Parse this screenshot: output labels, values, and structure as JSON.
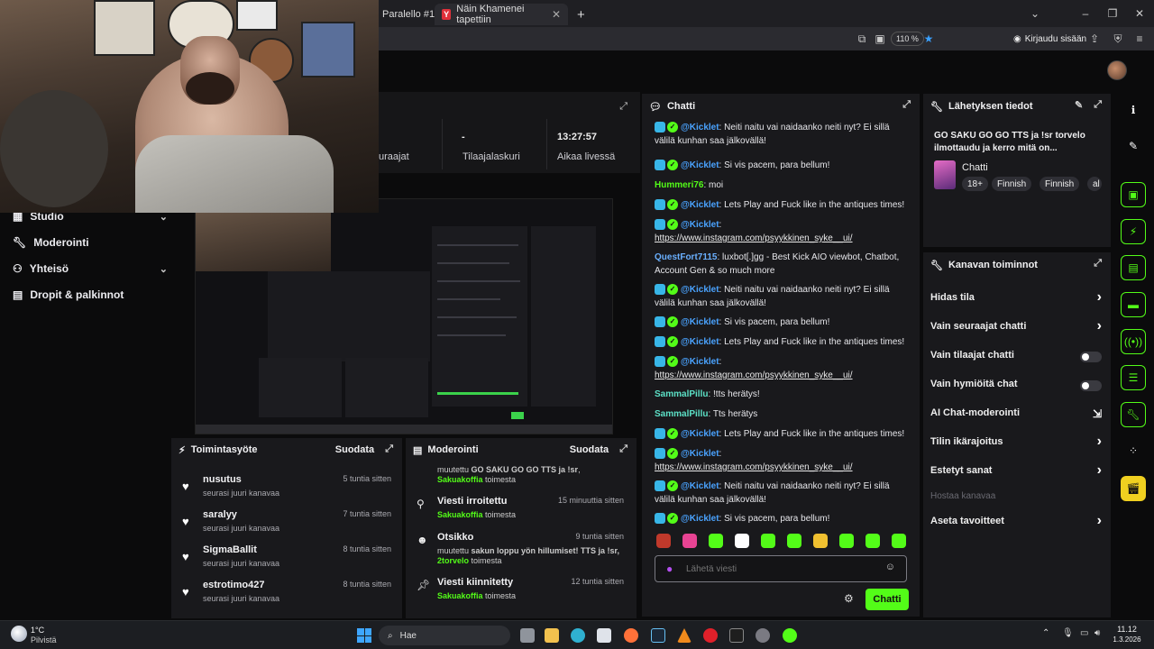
{
  "browser": {
    "tabs": [
      {
        "label": "Paralello #1"
      },
      {
        "label": "Näin Khamenei tapettiin",
        "icon_letter": "Y"
      }
    ],
    "new_tab": "+",
    "zoom": "110 %",
    "login": "Kirjaudu sisään"
  },
  "stats": {
    "col1_value": "",
    "col1_label": "uraajat",
    "col2_value": "-",
    "col2_label": "Tilaajalaskuri",
    "col3_value": "13:27:57",
    "col3_label": "Aikaa livessä"
  },
  "nav": {
    "items": [
      {
        "label": "Studio",
        "icon": "studio-icon",
        "has_chevron": true
      },
      {
        "label": "Moderointi",
        "icon": "wrench-icon",
        "has_chevron": false
      },
      {
        "label": "Yhteisö",
        "icon": "people-icon",
        "has_chevron": true
      },
      {
        "label": "Dropit & palkinnot",
        "icon": "gift-icon",
        "has_chevron": false
      }
    ]
  },
  "activity": {
    "title": "Toimintasyöte",
    "filter": "Suodata",
    "rows": [
      {
        "name": "nusutus",
        "sub": "seurasi juuri kanavaa",
        "time": "5 tuntia sitten"
      },
      {
        "name": "saralyy",
        "sub": "seurasi juuri kanavaa",
        "time": "7 tuntia sitten"
      },
      {
        "name": "SigmaBallit",
        "sub": "seurasi juuri kanavaa",
        "time": "8 tuntia sitten"
      },
      {
        "name": "estrotimo427",
        "sub": "seurasi juuri kanavaa",
        "time": "8 tuntia sitten"
      }
    ]
  },
  "moderation": {
    "title": "Moderointi",
    "filter": "Suodata",
    "top": {
      "pre": "muutettu ",
      "bold": "GO SAKU GO GO TTS ja !sr",
      "mid": ", ",
      "user": "Sakuakoffia",
      "post": " toimesta"
    },
    "rows": [
      {
        "title": "Viesti irroitettu",
        "time": "15 minuuttia sitten",
        "user": "Sakuakoffia",
        "post": " toimesta",
        "pre": "",
        "bold": ""
      },
      {
        "title": "Otsikko",
        "time": "9 tuntia sitten",
        "pre": "muutettu ",
        "bold": "sakun loppu yön hillumiset! TTS ja !sr, ",
        "user": "2torvelo",
        "post": " toimesta"
      },
      {
        "title": "Viesti kiinnitetty",
        "time": "12 tuntia sitten",
        "user": "Sakuakoffia",
        "post": " toimesta",
        "pre": "",
        "bold": ""
      }
    ]
  },
  "chat": {
    "title": "Chatti",
    "messages": [
      {
        "bot": true,
        "user": "@Kicklet",
        "style": "kick",
        "text": ": Neiti naitu vai naidaanko neiti nyt? Ei sillä välilä kunhan saa jälkovällä!"
      },
      {
        "bot": true,
        "user": "@Kicklet",
        "style": "kick",
        "text": ": Si vis pacem, para bellum!"
      },
      {
        "bot": false,
        "user": "Hummeri76",
        "style": "green",
        "text": ": moi"
      },
      {
        "bot": true,
        "user": "@Kicklet",
        "style": "kick",
        "text": ": Lets Play and Fuck like in the antiques times!"
      },
      {
        "bot": true,
        "user": "@Kicklet",
        "style": "kick",
        "text": ": ",
        "link": "https://www.instagram.com/psyykkinen_syke__ui/"
      },
      {
        "bot": false,
        "user": "QuestFort7115",
        "style": "blue",
        "text": ": luxbot[.]gg - Best Kick AIO viewbot, Chatbot, Account Gen & so much more"
      },
      {
        "bot": true,
        "user": "@Kicklet",
        "style": "kick",
        "text": ": Neiti naitu vai naidaanko neiti nyt? Ei sillä välilä kunhan saa jälkovällä!"
      },
      {
        "bot": true,
        "user": "@Kicklet",
        "style": "kick",
        "text": ": Si vis pacem, para bellum!"
      },
      {
        "bot": true,
        "user": "@Kicklet",
        "style": "kick",
        "text": ": Lets Play and Fuck like in the antiques times!"
      },
      {
        "bot": true,
        "user": "@Kicklet",
        "style": "kick",
        "text": ": ",
        "link": "https://www.instagram.com/psyykkinen_syke__ui/"
      },
      {
        "bot": false,
        "user": "SammalPillu",
        "style": "teal",
        "text": ": !tts herätys!"
      },
      {
        "bot": false,
        "user": "SammalPillu",
        "style": "teal",
        "text": ": Tts herätys"
      },
      {
        "bot": true,
        "user": "@Kicklet",
        "style": "kick",
        "text": ": Lets Play and Fuck like in the antiques times!"
      },
      {
        "bot": true,
        "user": "@Kicklet",
        "style": "kick",
        "text": ": ",
        "link": "https://www.instagram.com/psyykkinen_syke__ui/"
      },
      {
        "bot": true,
        "user": "@Kicklet",
        "style": "kick",
        "text": ": Neiti naitu vai naidaanko neiti nyt? Ei sillä välilä kunhan saa jälkovällä!"
      },
      {
        "bot": true,
        "user": "@Kicklet",
        "style": "kick",
        "text": ": Si vis pacem, para bellum!"
      }
    ],
    "input_placeholder": "Lähetä viesti",
    "send_label": "Chatti",
    "emote_colors": [
      "#c0392b",
      "#e84393",
      "#53fc18",
      "#ffffff",
      "#53fc18",
      "#53fc18",
      "#f0c030",
      "#53fc18",
      "#53fc18",
      "#53fc18"
    ]
  },
  "stream_info": {
    "title": "Lähetyksen tiedot",
    "stream_title": "GO SAKU GO GO TTS ja !sr torvelo ilmottaudu ja kerro mitä on...",
    "category": "Chatti",
    "tags": [
      "18+",
      "Finnish",
      "Finnish",
      "al"
    ]
  },
  "channel_actions": {
    "title": "Kanavan toiminnot",
    "items": [
      {
        "label": "Hidas tila",
        "kind": "chevron"
      },
      {
        "label": "Vain seuraajat chatti",
        "kind": "chevron"
      },
      {
        "label": "Vain tilaajat chatti",
        "kind": "toggle"
      },
      {
        "label": "Vain hymiöitä chat",
        "kind": "toggle"
      },
      {
        "label": "AI Chat-moderointi",
        "kind": "external"
      },
      {
        "label": "Tilin ikärajoitus",
        "kind": "chevron"
      },
      {
        "label": "Estetyt sanat",
        "kind": "chevron"
      },
      {
        "label": "Hostaa kanavaa",
        "kind": "disabled"
      },
      {
        "label": "Aseta tavoitteet",
        "kind": "chevron"
      }
    ]
  },
  "taskbar": {
    "weather_temp": "1°C",
    "weather_desc": "Pilvistä",
    "search": "Hae",
    "time": "11.12",
    "date": "1.3.2026"
  },
  "colors": {
    "accent": "#53fc18",
    "panel": "#19191c",
    "background": "#0b0b0c"
  }
}
